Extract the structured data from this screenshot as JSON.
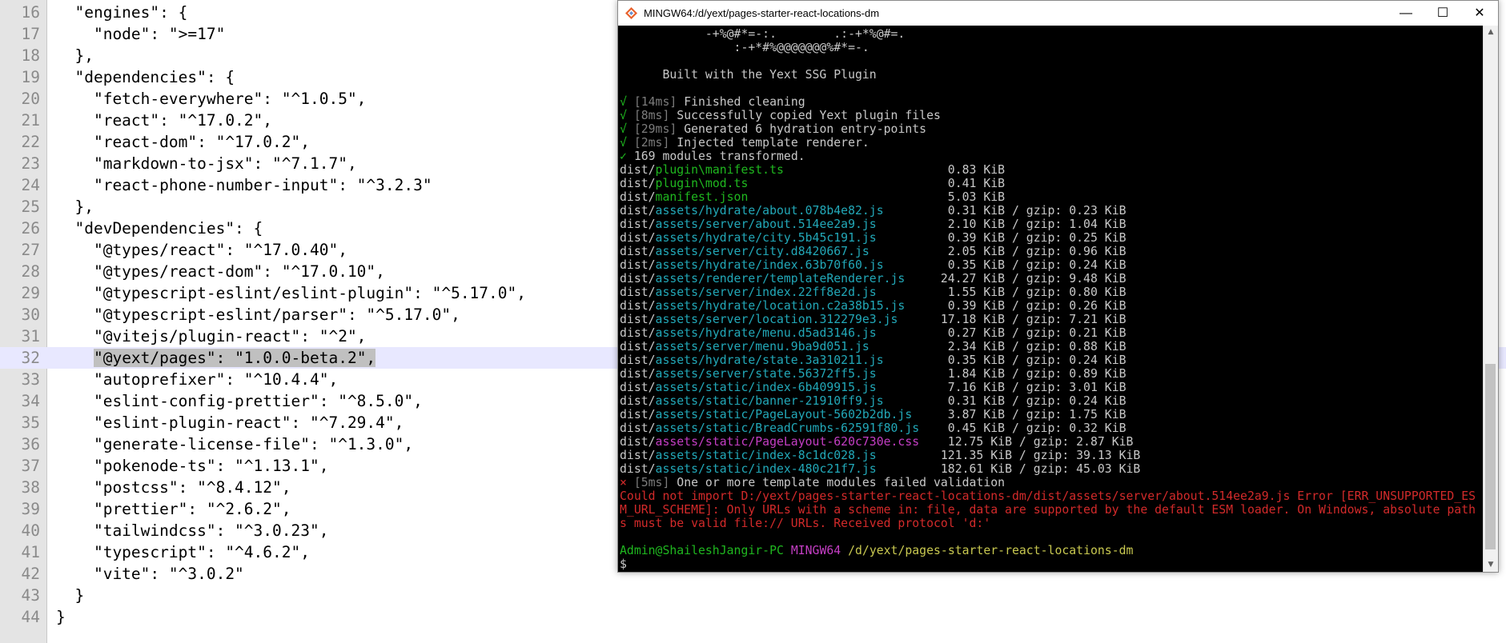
{
  "editor": {
    "lines": [
      {
        "num": "16",
        "code": "  \"engines\": {"
      },
      {
        "num": "17",
        "code": "    \"node\": \">=17\""
      },
      {
        "num": "18",
        "code": "  },"
      },
      {
        "num": "19",
        "code": "  \"dependencies\": {"
      },
      {
        "num": "20",
        "code": "    \"fetch-everywhere\": \"^1.0.5\","
      },
      {
        "num": "21",
        "code": "    \"react\": \"^17.0.2\","
      },
      {
        "num": "22",
        "code": "    \"react-dom\": \"^17.0.2\","
      },
      {
        "num": "23",
        "code": "    \"markdown-to-jsx\": \"^7.1.7\","
      },
      {
        "num": "24",
        "code": "    \"react-phone-number-input\": \"^3.2.3\""
      },
      {
        "num": "25",
        "code": "  },"
      },
      {
        "num": "26",
        "code": "  \"devDependencies\": {"
      },
      {
        "num": "27",
        "code": "    \"@types/react\": \"^17.0.40\","
      },
      {
        "num": "28",
        "code": "    \"@types/react-dom\": \"^17.0.10\","
      },
      {
        "num": "29",
        "code": "    \"@typescript-eslint/eslint-plugin\": \"^5.17.0\","
      },
      {
        "num": "30",
        "code": "    \"@typescript-eslint/parser\": \"^5.17.0\","
      },
      {
        "num": "31",
        "code": "    \"@vitejs/plugin-react\": \"^2\","
      },
      {
        "num": "32",
        "code_indent": "    ",
        "code_selected": "\"@yext/pages\": \"1.0.0-beta.2\",",
        "active": true
      },
      {
        "num": "33",
        "code": "    \"autoprefixer\": \"^10.4.4\","
      },
      {
        "num": "34",
        "code": "    \"eslint-config-prettier\": \"^8.5.0\","
      },
      {
        "num": "35",
        "code": "    \"eslint-plugin-react\": \"^7.29.4\","
      },
      {
        "num": "36",
        "code": "    \"generate-license-file\": \"^1.3.0\","
      },
      {
        "num": "37",
        "code": "    \"pokenode-ts\": \"^1.13.1\","
      },
      {
        "num": "38",
        "code": "    \"postcss\": \"^8.4.12\","
      },
      {
        "num": "39",
        "code": "    \"prettier\": \"^2.6.2\","
      },
      {
        "num": "40",
        "code": "    \"tailwindcss\": \"^3.0.23\","
      },
      {
        "num": "41",
        "code": "    \"typescript\": \"^4.6.2\","
      },
      {
        "num": "42",
        "code": "    \"vite\": \"^3.0.2\""
      },
      {
        "num": "43",
        "code": "  }"
      },
      {
        "num": "44",
        "code": "}"
      }
    ]
  },
  "terminal": {
    "title": "MINGW64:/d/yext/pages-starter-react-locations-dm",
    "controls": {
      "minimize": "—",
      "maximize": "☐",
      "close": "✕"
    },
    "lines": [
      {
        "segs": [
          {
            "t": "            -+%@#*=-:.        .:-+*%@#=.",
            "c": "white"
          }
        ]
      },
      {
        "segs": [
          {
            "t": "                :-+*#%@@@@@@@%#*=-.",
            "c": "white"
          }
        ]
      },
      {
        "segs": []
      },
      {
        "segs": [
          {
            "t": "      Built with the Yext SSG Plugin",
            "c": "white"
          }
        ]
      },
      {
        "segs": []
      },
      {
        "segs": [
          {
            "t": "√ ",
            "c": "green"
          },
          {
            "t": "[14ms]",
            "c": "gray"
          },
          {
            "t": " Finished cleaning",
            "c": "white"
          }
        ]
      },
      {
        "segs": [
          {
            "t": "√ ",
            "c": "green"
          },
          {
            "t": "[8ms]",
            "c": "gray"
          },
          {
            "t": " Successfully copied Yext plugin files",
            "c": "white"
          }
        ]
      },
      {
        "segs": [
          {
            "t": "√ ",
            "c": "green"
          },
          {
            "t": "[29ms]",
            "c": "gray"
          },
          {
            "t": " Generated 6 hydration entry-points",
            "c": "white"
          }
        ]
      },
      {
        "segs": [
          {
            "t": "√ ",
            "c": "green"
          },
          {
            "t": "[2ms]",
            "c": "gray"
          },
          {
            "t": " Injected template renderer.",
            "c": "white"
          }
        ]
      },
      {
        "segs": [
          {
            "t": "✓ ",
            "c": "green"
          },
          {
            "t": "169 modules transformed.",
            "c": "white"
          }
        ]
      },
      {
        "segs": [
          {
            "t": "dist/",
            "c": "white"
          },
          {
            "t": "plugin\\manifest.ts                       ",
            "c": "green"
          },
          {
            "t": "0.83 KiB",
            "c": "white"
          }
        ]
      },
      {
        "segs": [
          {
            "t": "dist/",
            "c": "white"
          },
          {
            "t": "plugin\\mod.ts                            ",
            "c": "green"
          },
          {
            "t": "0.41 KiB",
            "c": "white"
          }
        ]
      },
      {
        "segs": [
          {
            "t": "dist/",
            "c": "white"
          },
          {
            "t": "manifest.json                            ",
            "c": "green"
          },
          {
            "t": "5.03 KiB",
            "c": "white"
          }
        ]
      },
      {
        "segs": [
          {
            "t": "dist/",
            "c": "white"
          },
          {
            "t": "assets/hydrate/about.078b4e82.js         ",
            "c": "cyan"
          },
          {
            "t": "0.31 KiB / gzip: 0.23 KiB",
            "c": "white"
          }
        ]
      },
      {
        "segs": [
          {
            "t": "dist/",
            "c": "white"
          },
          {
            "t": "assets/server/about.514ee2a9.js          ",
            "c": "cyan"
          },
          {
            "t": "2.10 KiB / gzip: 1.04 KiB",
            "c": "white"
          }
        ]
      },
      {
        "segs": [
          {
            "t": "dist/",
            "c": "white"
          },
          {
            "t": "assets/hydrate/city.5b45c191.js          ",
            "c": "cyan"
          },
          {
            "t": "0.39 KiB / gzip: 0.25 KiB",
            "c": "white"
          }
        ]
      },
      {
        "segs": [
          {
            "t": "dist/",
            "c": "white"
          },
          {
            "t": "assets/server/city.d8420667.js           ",
            "c": "cyan"
          },
          {
            "t": "2.05 KiB / gzip: 0.96 KiB",
            "c": "white"
          }
        ]
      },
      {
        "segs": [
          {
            "t": "dist/",
            "c": "white"
          },
          {
            "t": "assets/hydrate/index.63b70f60.js         ",
            "c": "cyan"
          },
          {
            "t": "0.35 KiB / gzip: 0.24 KiB",
            "c": "white"
          }
        ]
      },
      {
        "segs": [
          {
            "t": "dist/",
            "c": "white"
          },
          {
            "t": "assets/renderer/templateRenderer.js     ",
            "c": "cyan"
          },
          {
            "t": "24.27 KiB / gzip: 9.48 KiB",
            "c": "white"
          }
        ]
      },
      {
        "segs": [
          {
            "t": "dist/",
            "c": "white"
          },
          {
            "t": "assets/server/index.22ff8e2d.js          ",
            "c": "cyan"
          },
          {
            "t": "1.55 KiB / gzip: 0.80 KiB",
            "c": "white"
          }
        ]
      },
      {
        "segs": [
          {
            "t": "dist/",
            "c": "white"
          },
          {
            "t": "assets/hydrate/location.c2a38b15.js      ",
            "c": "cyan"
          },
          {
            "t": "0.39 KiB / gzip: 0.26 KiB",
            "c": "white"
          }
        ]
      },
      {
        "segs": [
          {
            "t": "dist/",
            "c": "white"
          },
          {
            "t": "assets/server/location.312279e3.js      ",
            "c": "cyan"
          },
          {
            "t": "17.18 KiB / gzip: 7.21 KiB",
            "c": "white"
          }
        ]
      },
      {
        "segs": [
          {
            "t": "dist/",
            "c": "white"
          },
          {
            "t": "assets/hydrate/menu.d5ad3146.js          ",
            "c": "cyan"
          },
          {
            "t": "0.27 KiB / gzip: 0.21 KiB",
            "c": "white"
          }
        ]
      },
      {
        "segs": [
          {
            "t": "dist/",
            "c": "white"
          },
          {
            "t": "assets/server/menu.9ba9d051.js           ",
            "c": "cyan"
          },
          {
            "t": "2.34 KiB / gzip: 0.88 KiB",
            "c": "white"
          }
        ]
      },
      {
        "segs": [
          {
            "t": "dist/",
            "c": "white"
          },
          {
            "t": "assets/hydrate/state.3a310211.js         ",
            "c": "cyan"
          },
          {
            "t": "0.35 KiB / gzip: 0.24 KiB",
            "c": "white"
          }
        ]
      },
      {
        "segs": [
          {
            "t": "dist/",
            "c": "white"
          },
          {
            "t": "assets/server/state.56372ff5.js          ",
            "c": "cyan"
          },
          {
            "t": "1.84 KiB / gzip: 0.89 KiB",
            "c": "white"
          }
        ]
      },
      {
        "segs": [
          {
            "t": "dist/",
            "c": "white"
          },
          {
            "t": "assets/static/index-6b409915.js          ",
            "c": "cyan"
          },
          {
            "t": "7.16 KiB / gzip: 3.01 KiB",
            "c": "white"
          }
        ]
      },
      {
        "segs": [
          {
            "t": "dist/",
            "c": "white"
          },
          {
            "t": "assets/static/banner-21910ff9.js         ",
            "c": "cyan"
          },
          {
            "t": "0.31 KiB / gzip: 0.24 KiB",
            "c": "white"
          }
        ]
      },
      {
        "segs": [
          {
            "t": "dist/",
            "c": "white"
          },
          {
            "t": "assets/static/PageLayout-5602b2db.js     ",
            "c": "cyan"
          },
          {
            "t": "3.87 KiB / gzip: 1.75 KiB",
            "c": "white"
          }
        ]
      },
      {
        "segs": [
          {
            "t": "dist/",
            "c": "white"
          },
          {
            "t": "assets/static/BreadCrumbs-62591f80.js    ",
            "c": "cyan"
          },
          {
            "t": "0.45 KiB / gzip: 0.32 KiB",
            "c": "white"
          }
        ]
      },
      {
        "segs": [
          {
            "t": "dist/",
            "c": "white"
          },
          {
            "t": "assets/static/PageLayout-620c730e.css    ",
            "c": "magenta"
          },
          {
            "t": "12.75 KiB / gzip: 2.87 KiB",
            "c": "white"
          }
        ]
      },
      {
        "segs": [
          {
            "t": "dist/",
            "c": "white"
          },
          {
            "t": "assets/static/index-8c1dc028.js         ",
            "c": "cyan"
          },
          {
            "t": "121.35 KiB / gzip: 39.13 KiB",
            "c": "white"
          }
        ]
      },
      {
        "segs": [
          {
            "t": "dist/",
            "c": "white"
          },
          {
            "t": "assets/static/index-480c21f7.js         ",
            "c": "cyan"
          },
          {
            "t": "182.61 KiB / gzip: 45.03 KiB",
            "c": "white"
          }
        ]
      },
      {
        "segs": [
          {
            "t": "× ",
            "c": "red"
          },
          {
            "t": "[5ms]",
            "c": "gray"
          },
          {
            "t": " One or more template modules failed validation",
            "c": "white"
          }
        ]
      },
      {
        "segs": [
          {
            "t": "Could not import D:/yext/pages-starter-react-locations-dm/dist/assets/server/about.514ee2a9.js Error [ERR_UNSUPPORTED_ES",
            "c": "red"
          }
        ]
      },
      {
        "segs": [
          {
            "t": "M_URL_SCHEME]: Only URLs with a scheme in: file, data are supported by the default ESM loader. On Windows, absolute path",
            "c": "red"
          }
        ]
      },
      {
        "segs": [
          {
            "t": "s must be valid file:// URLs. Received protocol 'd:'",
            "c": "red"
          }
        ]
      },
      {
        "segs": []
      },
      {
        "segs": [
          {
            "t": "Admin@ShaileshJangir-PC",
            "c": "green"
          },
          {
            "t": " ",
            "c": "white"
          },
          {
            "t": "MINGW64",
            "c": "magenta"
          },
          {
            "t": " /d/yext/pages-starter-react-locations-dm",
            "c": "yellow"
          }
        ]
      },
      {
        "segs": [
          {
            "t": "$",
            "c": "white"
          }
        ]
      }
    ]
  }
}
